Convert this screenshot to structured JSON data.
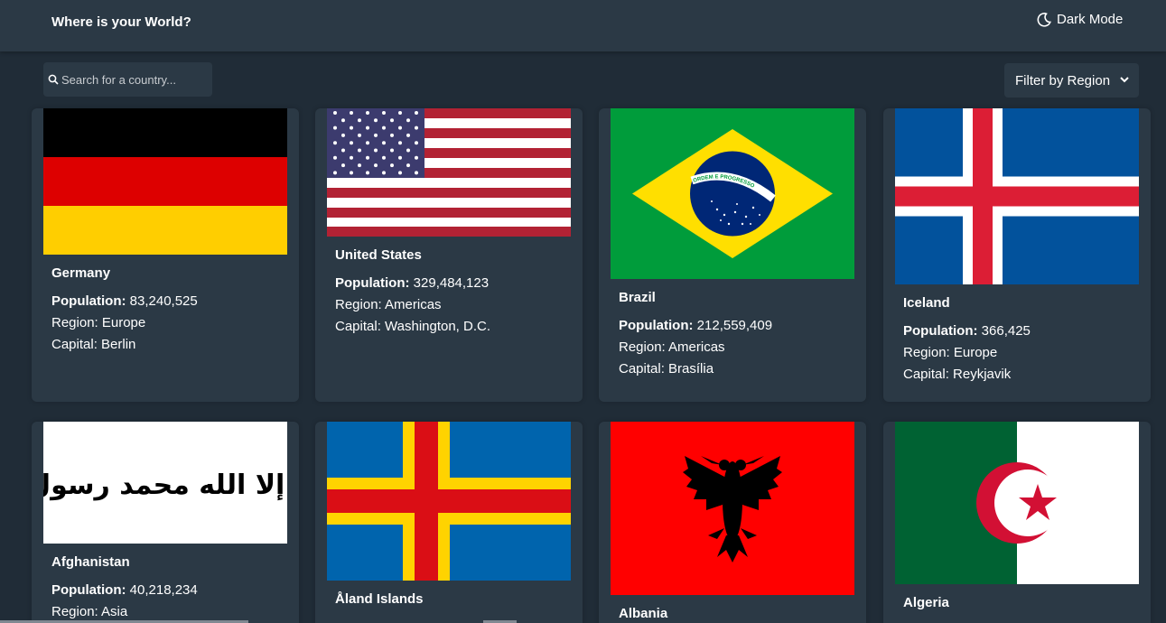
{
  "header": {
    "title": "Where is your World?",
    "mode_label": "Dark Mode",
    "mode_icon": "moon-icon"
  },
  "search": {
    "placeholder": "Search for a country...",
    "icon": "search-icon"
  },
  "filter": {
    "label": "Filter by Region",
    "icon": "chevron-down-icon"
  },
  "labels": {
    "population": "Population:",
    "region": "Region:",
    "capital": "Capital:"
  },
  "countries": [
    {
      "name": "Germany",
      "population": "83,240,525",
      "region": "Europe",
      "capital": "Berlin"
    },
    {
      "name": "United States",
      "population": "329,484,123",
      "region": "Americas",
      "capital": "Washington, D.C."
    },
    {
      "name": "Brazil",
      "population": "212,559,409",
      "region": "Americas",
      "capital": "Brasília"
    },
    {
      "name": "Iceland",
      "population": "366,425",
      "region": "Europe",
      "capital": "Reykjavik"
    },
    {
      "name": "Afghanistan",
      "population": "40,218,234",
      "region": "Asia",
      "capital": ""
    },
    {
      "name": "Åland Islands",
      "population": "",
      "region": "",
      "capital": ""
    },
    {
      "name": "Albania",
      "population": "",
      "region": "",
      "capital": ""
    },
    {
      "name": "Algeria",
      "population": "",
      "region": "",
      "capital": ""
    }
  ],
  "brazil_motto": "ORDEM E PROGRESSO",
  "afghan_flag_text": "لا إله إلا الله محمد رسول الله",
  "colors": {
    "background": "#202c37",
    "elements": "#2b3945",
    "text": "#ffffff"
  }
}
